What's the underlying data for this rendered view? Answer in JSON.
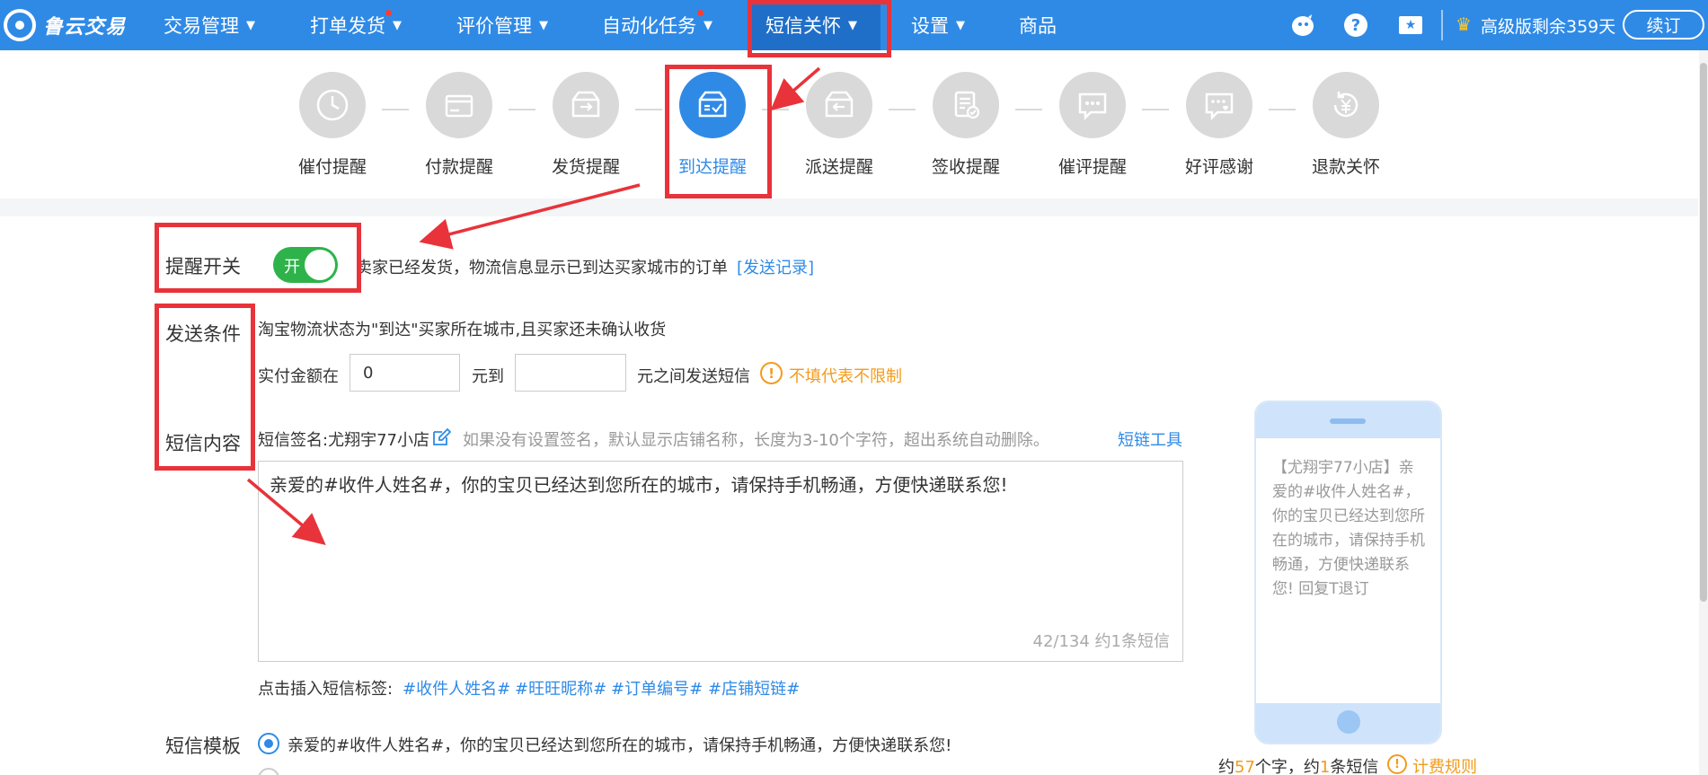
{
  "nav": {
    "logo_text": "鲁云交易",
    "items": [
      {
        "label": "交易管理"
      },
      {
        "label": "打单发货"
      },
      {
        "label": "评价管理"
      },
      {
        "label": "自动化任务"
      },
      {
        "label": "短信关怀"
      },
      {
        "label": "设置"
      },
      {
        "label": "商品"
      }
    ],
    "help_label": "?",
    "plan_status": "高级版剩余359天",
    "renew_label": "续订"
  },
  "steps": [
    {
      "label": "催付提醒",
      "icon": "clock-icon"
    },
    {
      "label": "付款提醒",
      "icon": "card-icon"
    },
    {
      "label": "发货提醒",
      "icon": "box-out-icon"
    },
    {
      "label": "到达提醒",
      "icon": "box-check-icon",
      "active": true
    },
    {
      "label": "派送提醒",
      "icon": "box-deliver-icon"
    },
    {
      "label": "签收提醒",
      "icon": "sign-doc-icon"
    },
    {
      "label": "催评提醒",
      "icon": "chat-bubble-icon"
    },
    {
      "label": "好评感谢",
      "icon": "heart-chat-icon"
    },
    {
      "label": "退款关怀",
      "icon": "refund-icon"
    }
  ],
  "reminder": {
    "label": "提醒开关",
    "toggle_text": "开",
    "description": "卖家已经发货，物流信息显示已到达买家城市的订单",
    "record_link": "[发送记录]"
  },
  "condition": {
    "label": "发送条件",
    "text": "淘宝物流状态为\"到达\"买家所在城市,且买家还未确认收货",
    "amount_prefix": "实付金额在",
    "min_value": "0",
    "amount_mid": "元到",
    "max_value": "",
    "amount_suffix": "元之间发送短信",
    "hint": "不填代表不限制"
  },
  "content": {
    "label": "短信内容",
    "signature": "短信签名:尤翔宇77小店",
    "signature_hint": "如果没有设置签名，默认显示店铺名称，长度为3-10个字符，超出系统自动删除。",
    "link_tool": "短链工具",
    "message": "亲爱的#收件人姓名#，你的宝贝已经达到您所在的城市，请保持手机畅通，方便快递联系您!",
    "counter": "42/134   约1条短信",
    "tags_prefix": "点击插入短信标签:",
    "tags": [
      "#收件人姓名#",
      "#旺旺昵称#",
      "#订单编号#",
      "#店铺短链#"
    ]
  },
  "template": {
    "label": "短信模板",
    "option1": "亲爱的#收件人姓名#，你的宝贝已经达到您所在的城市，请保持手机畅通，方便快递联系您!"
  },
  "preview": {
    "text": "【尤翔宇77小店】亲爱的#收件人姓名#，你的宝贝已经达到您所在的城市，请保持手机畅通，方便快递联系您!  回复T退订",
    "summary_prefix": "约",
    "char_count": "57",
    "summary_mid": "个字，约",
    "sms_count": "1",
    "summary_suffix": "条短信",
    "billing_link": "计费规则"
  },
  "colors": {
    "primary": "#2f8ae6",
    "toggle_on": "#2db34a",
    "warning": "#f39b1c",
    "annotation": "#e8333a"
  }
}
